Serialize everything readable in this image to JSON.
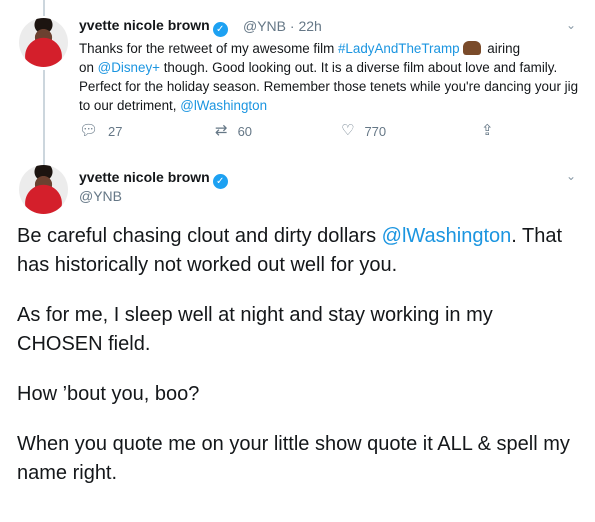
{
  "tweet1": {
    "name": "yvette nicole brown",
    "handle": "@YNB",
    "separator": "·",
    "time": "22h",
    "text_1": "Thanks for the retweet of my awesome film ",
    "hashtag": "#LadyAndTheTramp",
    "text_2": " airing",
    "text_3": "on ",
    "mention_disney": "@Disney+",
    "text_4": " though. Good looking out. It is a diverse film about love and family. Perfect for the holiday season. Remember those tenets while you're dancing your jig to our detriment, ",
    "mention_washington": "@lWashington",
    "replies": "27",
    "retweets": "60",
    "likes": "770",
    "icons": {
      "reply": "reply-icon",
      "retweet": "retweet-icon",
      "like": "heart-icon",
      "share": "share-icon",
      "verified": "verified-badge-icon",
      "menu": "chevron-down-icon",
      "emoji": "dog-emoji-icon"
    }
  },
  "tweet2": {
    "name": "yvette nicole brown",
    "handle": "@YNB",
    "p1_text": "Be careful chasing clout and dirty dollars ",
    "p1_mention": "@lWashington",
    "p1_end": ". That has historically not worked out well for you.",
    "p2": "As for me, I sleep well at night and stay working in my CHOSEN field.",
    "p3": "How ’bout you, boo?",
    "p4": "When you quote me on your little show quote it ALL & spell my name right."
  },
  "colors": {
    "link": "#1b95e0",
    "verified": "#1da1f2",
    "muted": "#657786",
    "thread": "#ccd6dd"
  }
}
